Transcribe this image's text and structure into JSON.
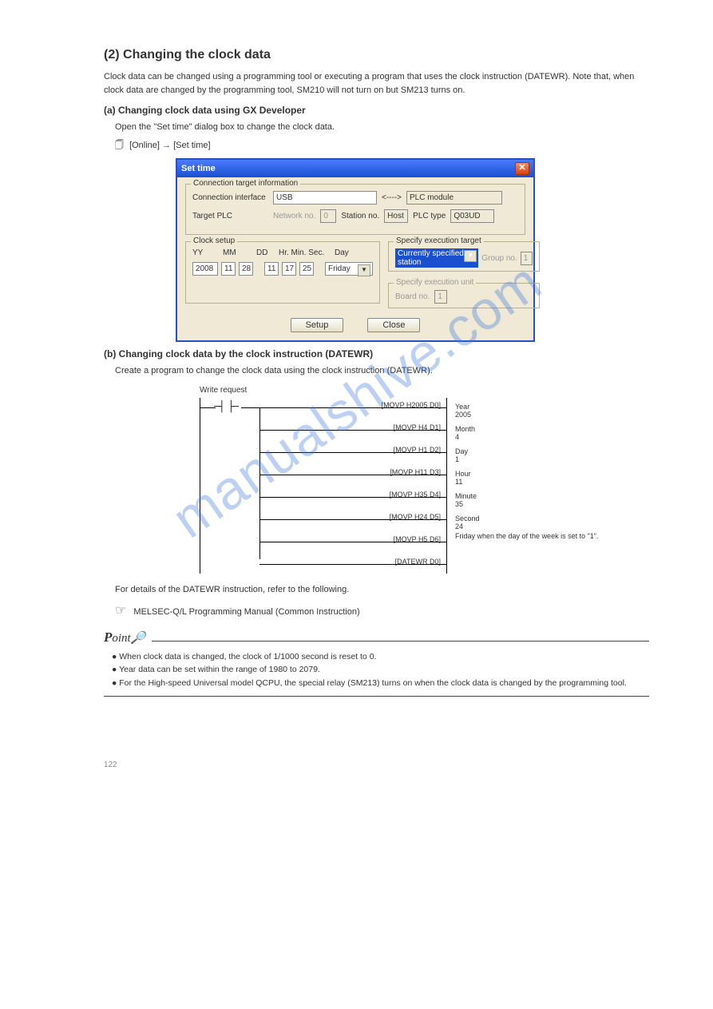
{
  "watermark": "manualshive.com",
  "section": {
    "number": "(2)",
    "title": "Changing the clock data",
    "intro": "Clock data can be changed using a programming tool or executing a program that uses the clock instruction (DATEWR). Note that, when clock data are changed by the programming tool, SM210 will not turn on but SM213 turns on.",
    "a_title": "(a) Changing clock data using GX Developer",
    "a_desc1": "Open the \"Set time\" dialog box to change the clock data.",
    "a_path": "[Online]   [Set time]",
    "arrow": "→",
    "b_title": "(b) Changing clock data by the clock instruction (DATEWR)",
    "b_desc": "Create a program to change the clock data using the clock instruction (DATEWR).",
    "b_tail": "For details of the DATEWR instruction, refer to the following.",
    "b_ref": "MELSEC-Q/L Programming Manual (Common Instruction)"
  },
  "dialog": {
    "title": "Set time",
    "grp_conn": "Connection target information",
    "conn_if_lbl": "Connection interface",
    "conn_if_val": "USB",
    "conn_arrow": "<---->",
    "plc_module": "PLC module",
    "target_plc_lbl": "Target PLC",
    "network_lbl": "Network no.",
    "network_val": "0",
    "station_lbl": "Station no.",
    "station_val": "Host",
    "plctype_lbl": "PLC type",
    "plctype_val": "Q03UD",
    "grp_clock": "Clock setup",
    "hdr_yy": "YY",
    "hdr_mm": "MM",
    "hdr_dd": "DD",
    "hdr_hms": "Hr.  Min.  Sec.",
    "hdr_day": "Day",
    "yy": "2008",
    "mm": "11",
    "dd": "28",
    "hr": "11",
    "min": "17",
    "sec": "25",
    "day": "Friday",
    "grp_exec": "Specify execution target",
    "exec_combo": "Currently specified station",
    "group_no_lbl": "Group no.",
    "group_no_val": "1",
    "grp_unit": "Specify execution unit",
    "board_lbl": "Board no.",
    "board_val": "1",
    "btn_setup": "Setup",
    "btn_close": "Close"
  },
  "ladder": {
    "caption": "Write request",
    "r0": {
      "instr": "MOVP",
      "val": "H2005",
      "dst": "D0",
      "cmt": "Year 2005"
    },
    "r1": {
      "instr": "MOVP",
      "val": "H4",
      "dst": "D1",
      "cmt": "Month 4"
    },
    "r2": {
      "instr": "MOVP",
      "val": "H1",
      "dst": "D2",
      "cmt": "Day 1"
    },
    "r3": {
      "instr": "MOVP",
      "val": "H11",
      "dst": "D3",
      "cmt": "Hour 11"
    },
    "r4": {
      "instr": "MOVP",
      "val": "H35",
      "dst": "D4",
      "cmt": "Minute 35"
    },
    "r5": {
      "instr": "MOVP",
      "val": "H24",
      "dst": "D5",
      "cmt": "Second 24"
    },
    "r6": {
      "instr": "MOVP",
      "val": "H5",
      "dst": "D6",
      "cmt": "Friday when the day of the week is set to \"1\"."
    },
    "r7": {
      "instr": "DATEWR",
      "val": "",
      "dst": "D0",
      "cmt": ""
    }
  },
  "point": {
    "word_p": "P",
    "word_rest": "oint",
    "bullets": "● When clock data is changed, the clock of 1/1000 second is reset to 0.\n● Year data can be set within the range of 1980 to 2079.\n● For the High-speed Universal model QCPU, the special relay (SM213) turns on when the clock data is changed by the programming tool."
  },
  "footer": {
    "pg": "122",
    "right": ""
  }
}
